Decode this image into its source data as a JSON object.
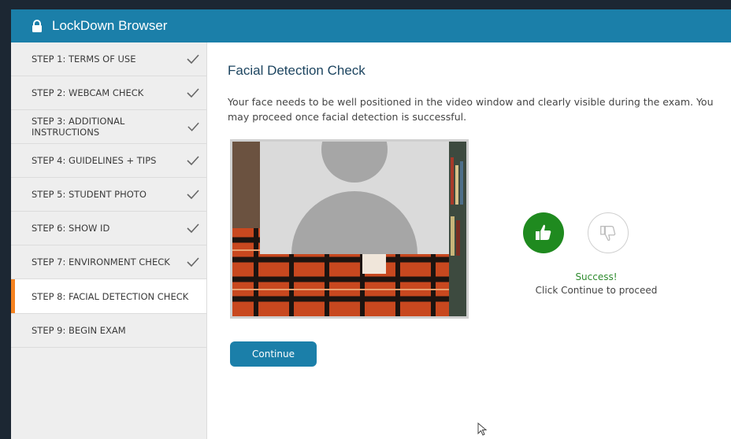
{
  "app": {
    "title": "LockDown Browser",
    "accent": "#1b7fa9",
    "active_color": "#f58220"
  },
  "sidebar": {
    "steps": [
      {
        "label": "STEP 1: TERMS OF USE",
        "done": true
      },
      {
        "label": "STEP 2: WEBCAM CHECK",
        "done": true
      },
      {
        "label": "STEP 3: ADDITIONAL INSTRUCTIONS",
        "done": true
      },
      {
        "label": "STEP 4: GUIDELINES + TIPS",
        "done": true
      },
      {
        "label": "STEP 5: STUDENT PHOTO",
        "done": true
      },
      {
        "label": "STEP 6: SHOW ID",
        "done": true
      },
      {
        "label": "STEP 7: ENVIRONMENT CHECK",
        "done": true
      },
      {
        "label": "STEP 8: FACIAL DETECTION CHECK",
        "active": true
      },
      {
        "label": "STEP 9: BEGIN EXAM"
      }
    ]
  },
  "main": {
    "heading": "Facial Detection Check",
    "description": "Your face needs to be well positioned in the video window and clearly visible during the exam. You may proceed once facial detection is successful.",
    "status_title": "Success!",
    "status_text": "Click Continue to proceed",
    "continue_label": "Continue",
    "icons": {
      "up": "thumbs-up-icon",
      "down": "thumbs-down-icon",
      "lock": "lock-icon",
      "check": "check-icon"
    }
  }
}
